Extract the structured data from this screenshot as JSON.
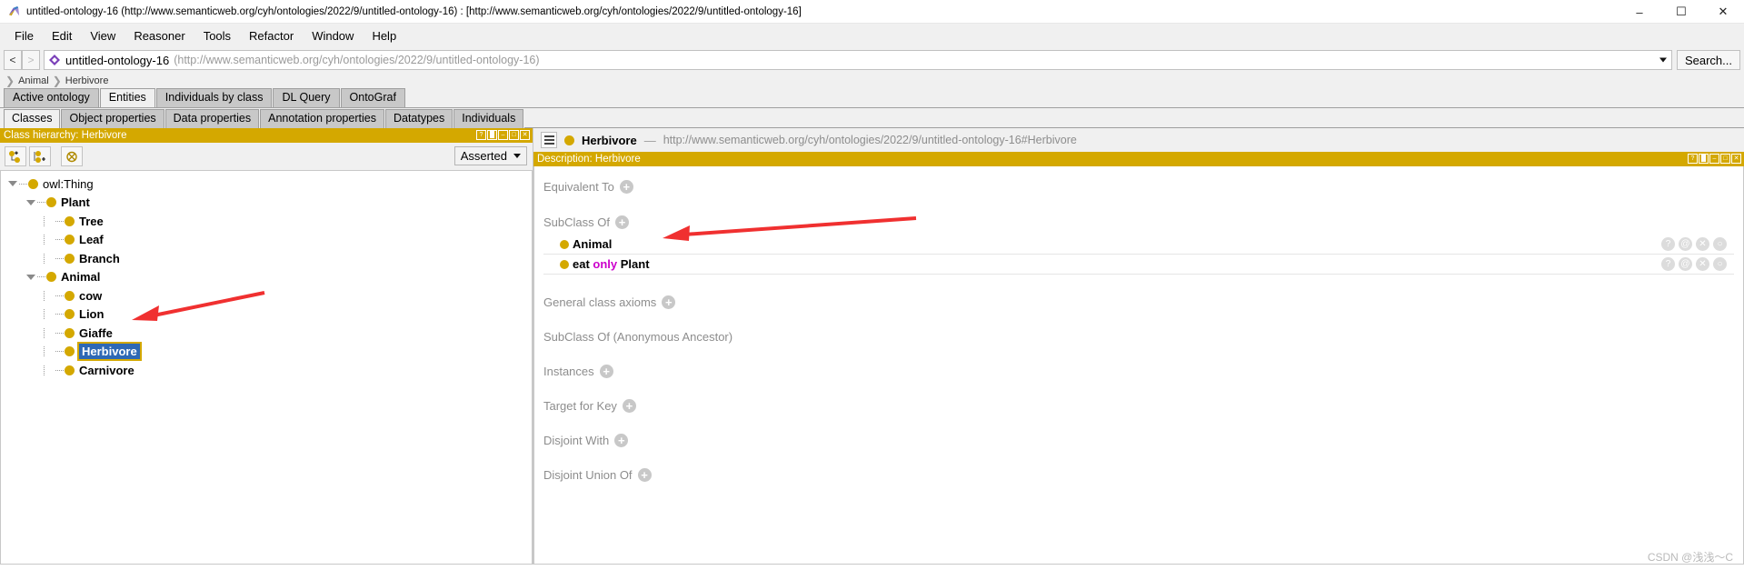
{
  "window": {
    "title": "untitled-ontology-16 (http://www.semanticweb.org/cyh/ontologies/2022/9/untitled-ontology-16)  : [http://www.semanticweb.org/cyh/ontologies/2022/9/untitled-ontology-16]",
    "app_icon": "protege-icon",
    "minimize": "–",
    "maximize": "☐",
    "close": "✕"
  },
  "menubar": {
    "items": [
      {
        "label": "File"
      },
      {
        "label": "Edit"
      },
      {
        "label": "View"
      },
      {
        "label": "Reasoner"
      },
      {
        "label": "Tools"
      },
      {
        "label": "Refactor"
      },
      {
        "label": "Window"
      },
      {
        "label": "Help"
      }
    ]
  },
  "ontology_bar": {
    "back_label": "<",
    "forward_label": ">",
    "ontology_name": "untitled-ontology-16",
    "ontology_iri": "(http://www.semanticweb.org/cyh/ontologies/2022/9/untitled-ontology-16)",
    "search_label": "Search..."
  },
  "breadcrumb": {
    "items": [
      {
        "label": "Animal"
      },
      {
        "label": "Herbivore"
      }
    ]
  },
  "tabs": {
    "items": [
      {
        "label": "Active ontology",
        "active": false
      },
      {
        "label": "Entities",
        "active": true
      },
      {
        "label": "Individuals by class",
        "active": false
      },
      {
        "label": "DL Query",
        "active": false
      },
      {
        "label": "OntoGraf",
        "active": false
      }
    ]
  },
  "subtabs": {
    "items": [
      {
        "label": "Classes",
        "active": true
      },
      {
        "label": "Object properties",
        "active": false
      },
      {
        "label": "Data properties",
        "active": false
      },
      {
        "label": "Annotation properties",
        "active": false
      },
      {
        "label": "Datatypes",
        "active": false
      },
      {
        "label": "Individuals",
        "active": false
      }
    ]
  },
  "class_hierarchy": {
    "header": "Class hierarchy: Herbivore",
    "header_controls": [
      "?",
      "▐▌",
      "–",
      "□",
      "✕"
    ],
    "toolbar": {
      "add_subclass": "add-subclass-icon",
      "add_sibling_class": "add-sibling-class-icon",
      "delete_class": "delete-class-icon"
    },
    "view_mode": "Asserted",
    "tree": [
      {
        "label": "owl:Thing",
        "depth": 0,
        "expandable": true,
        "expanded": true,
        "bold": false,
        "selected": false
      },
      {
        "label": "Plant",
        "depth": 1,
        "expandable": true,
        "expanded": true,
        "bold": true,
        "selected": false
      },
      {
        "label": "Tree",
        "depth": 2,
        "expandable": false,
        "expanded": false,
        "bold": true,
        "selected": false
      },
      {
        "label": "Leaf",
        "depth": 2,
        "expandable": false,
        "expanded": false,
        "bold": true,
        "selected": false
      },
      {
        "label": "Branch",
        "depth": 2,
        "expandable": false,
        "expanded": false,
        "bold": true,
        "selected": false
      },
      {
        "label": "Animal",
        "depth": 1,
        "expandable": true,
        "expanded": true,
        "bold": true,
        "selected": false
      },
      {
        "label": "cow",
        "depth": 2,
        "expandable": false,
        "expanded": false,
        "bold": true,
        "selected": false
      },
      {
        "label": "Lion",
        "depth": 2,
        "expandable": false,
        "expanded": false,
        "bold": true,
        "selected": false
      },
      {
        "label": "Giaffe",
        "depth": 2,
        "expandable": false,
        "expanded": false,
        "bold": true,
        "selected": false
      },
      {
        "label": "Herbivore",
        "depth": 2,
        "expandable": false,
        "expanded": false,
        "bold": true,
        "selected": true
      },
      {
        "label": "Carnivore",
        "depth": 2,
        "expandable": false,
        "expanded": false,
        "bold": true,
        "selected": false
      }
    ]
  },
  "entity_header": {
    "menu_icon": "hamburger-icon",
    "entity_name": "Herbivore",
    "separator": "—",
    "entity_iri": "http://www.semanticweb.org/cyh/ontologies/2022/9/untitled-ontology-16#Herbivore"
  },
  "description": {
    "header": "Description: Herbivore",
    "header_controls": [
      "?",
      "▐▌",
      "–",
      "□",
      "✕"
    ],
    "sections": [
      {
        "title": "Equivalent To",
        "add": "+",
        "rows": []
      },
      {
        "title": "SubClass Of",
        "add": "+",
        "rows": [
          {
            "text": "Animal",
            "keyword": "",
            "prefix": "",
            "suffix": ""
          },
          {
            "text": "",
            "prefix": "eat ",
            "keyword": "only",
            "suffix": " Plant"
          }
        ]
      },
      {
        "title": "General class axioms",
        "add": "+",
        "rows": []
      },
      {
        "title": "SubClass Of (Anonymous Ancestor)",
        "add": "",
        "rows": []
      },
      {
        "title": "Instances",
        "add": "+",
        "rows": []
      },
      {
        "title": "Target for Key",
        "add": "+",
        "rows": []
      },
      {
        "title": "Disjoint With",
        "add": "+",
        "rows": []
      },
      {
        "title": "Disjoint Union Of",
        "add": "+",
        "rows": []
      }
    ],
    "row_actions": [
      "?",
      "@",
      "✕",
      "○"
    ]
  },
  "watermark": "CSDN @浅浅～C",
  "colors": {
    "accent_gold": "#d4a800",
    "selection_blue": "#2e68b5",
    "keyword_magenta": "#cc00cc",
    "arrow_red": "#f03030",
    "panel_grey": "#f0f0f0"
  }
}
